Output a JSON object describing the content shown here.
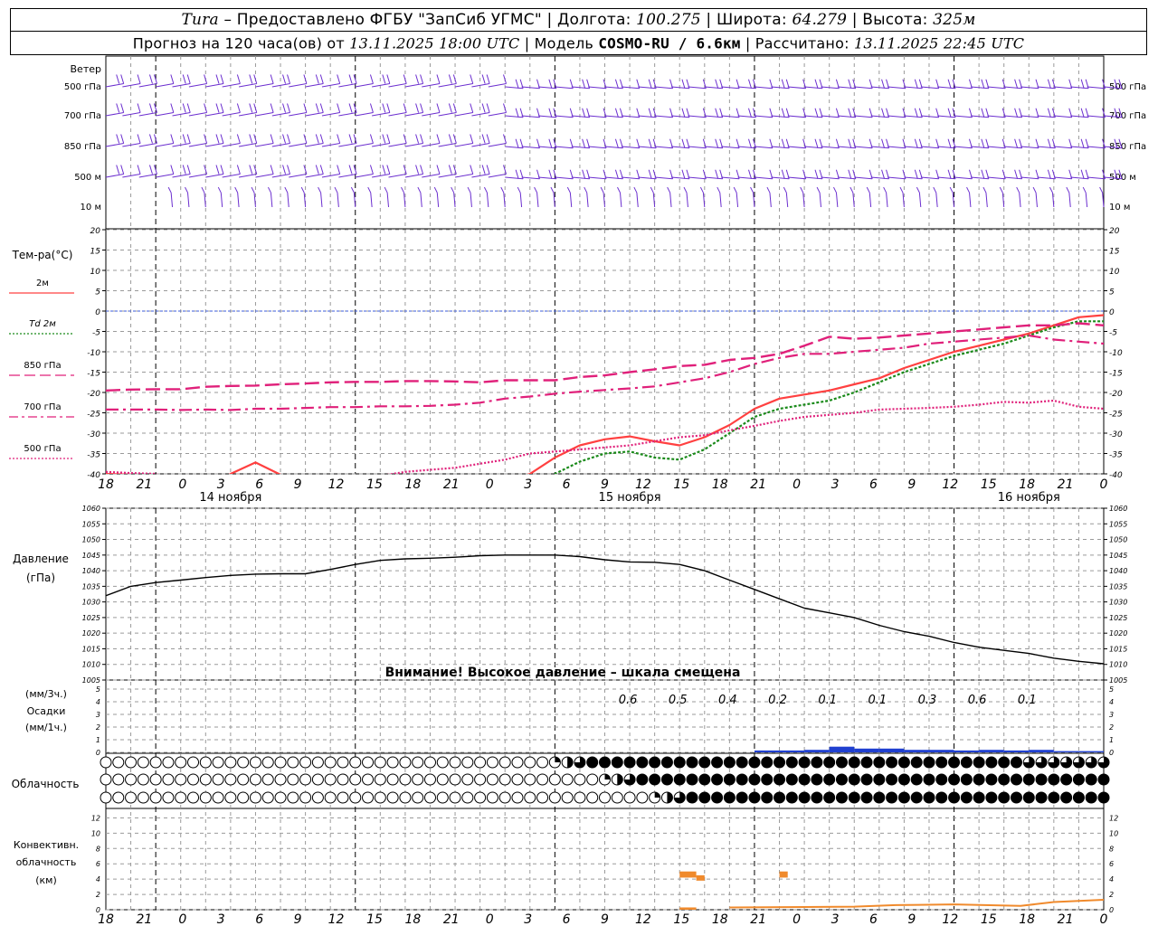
{
  "header": {
    "station": "Tura",
    "provider": " – Предоставлено ФГБУ \"ЗапСиб УГМС\" | Долгота: ",
    "longitude": "100.275",
    "lat_label": " | Широта: ",
    "latitude": "64.279",
    "alt_label": " | Высота: ",
    "altitude": "325м",
    "forecast_prefix": "Прогноз на 120 часа(ов) от ",
    "forecast_start": "13.11.2025 18:00 UTC",
    "model_label": "  | Модель ",
    "model": "COSMO-RU / 6.6км",
    "computed_label": " | Рассчитано: ",
    "computed": "13.11.2025 22:45 UTC"
  },
  "time_axis": {
    "hour_labels": [
      "18",
      "21",
      "0",
      "3",
      "6",
      "9",
      "12",
      "15",
      "18",
      "21",
      "0",
      "3",
      "6",
      "9",
      "12",
      "15",
      "18",
      "21",
      "0",
      "3",
      "6",
      "9",
      "12",
      "15",
      "18",
      "21",
      "0"
    ],
    "day_labels": [
      "14 ноября",
      "15 ноября",
      "16 ноября"
    ]
  },
  "wind": {
    "title": "Ветер",
    "levels": [
      "500 гПа",
      "700 гПа",
      "850 гПа",
      "500 м",
      "10  м"
    ]
  },
  "temperature": {
    "title": "Тем-ра(°C)",
    "legend": [
      {
        "label": "2м",
        "color": "#ff4040",
        "style": "solid"
      },
      {
        "label": "Td  2м",
        "color": "#1a8a1a",
        "style": "dotted"
      },
      {
        "label": "850 гПа",
        "color": "#e0207a",
        "style": "longdash"
      },
      {
        "label": "700 гПа",
        "color": "#e0207a",
        "style": "dashdot"
      },
      {
        "label": "500 гПа",
        "color": "#e0207a",
        "style": "dotted"
      }
    ],
    "ylim": [
      -40,
      20
    ],
    "ticks": [
      20,
      15,
      10,
      5,
      0,
      -5,
      -10,
      -15,
      -20,
      -25,
      -30,
      -35,
      -40
    ]
  },
  "pressure": {
    "title_line1": "Давление",
    "title_line2": "(гПа)",
    "ylim": [
      1005,
      1060
    ],
    "ticks": [
      1060,
      1055,
      1050,
      1045,
      1040,
      1035,
      1030,
      1025,
      1020,
      1015,
      1010,
      1005
    ],
    "warning": "Внимание! Высокое давление – шкала смещена"
  },
  "precip": {
    "unit3": "(мм/3ч.)",
    "title": "Осадки",
    "unit1": "(мм/1ч.)",
    "ticks": [
      5,
      4,
      3,
      2,
      1,
      0
    ],
    "totals": [
      "0.6",
      "0.5",
      "0.4",
      "0.2",
      "0.1",
      "0.1",
      "0.3",
      "0.6",
      "0.1"
    ]
  },
  "cloud": {
    "title": "Облачность"
  },
  "convective": {
    "title_line1": "Конвективн.",
    "title_line2": "облачность",
    "title_line3": "(км)",
    "ticks": [
      12,
      10,
      8,
      6,
      4,
      2,
      0
    ]
  },
  "chart_data": [
    {
      "type": "line",
      "title": "Тем-ра(°C)",
      "x_hours_from_start": [
        0,
        3,
        6,
        9,
        12,
        15,
        18,
        21,
        24,
        27,
        30,
        33,
        36,
        39,
        42,
        45,
        48,
        51,
        54,
        57,
        60,
        63,
        66,
        69,
        72,
        75,
        78,
        81,
        84,
        87,
        90,
        93,
        96,
        99,
        102,
        105,
        108,
        111,
        114,
        117,
        120
      ],
      "series": [
        {
          "name": "2м",
          "values": [
            -40,
            -40.2,
            -40.5,
            -42,
            -44,
            -40,
            -37.2,
            -40.2,
            -44,
            -46,
            -47,
            -48,
            -47,
            -47,
            -46,
            -44,
            -42,
            -40,
            -36,
            -33,
            -31.5,
            -30.8,
            -32,
            -33,
            -31,
            -28,
            -24,
            -21.5,
            -20.5,
            -19.5,
            -18,
            -16.5,
            -14,
            -12,
            -10,
            -8.5,
            -7,
            -5.5,
            -3.5,
            -1.5,
            -1
          ]
        },
        {
          "name": "Td  2м",
          "values": [
            -44,
            -44.5,
            -45,
            -46,
            -47,
            -44,
            -41,
            -43,
            -47,
            -49,
            -50,
            -51,
            -50,
            -50,
            -49,
            -47,
            -45,
            -43,
            -40,
            -37,
            -35,
            -34.5,
            -36,
            -36.5,
            -34,
            -30,
            -26,
            -24,
            -23,
            -22,
            -20,
            -17.5,
            -15,
            -13,
            -11,
            -9.5,
            -8,
            -6,
            -4,
            -2.5,
            -2.5
          ]
        },
        {
          "name": "850 гПа",
          "values": [
            -19.5,
            -19.3,
            -19.2,
            -19.2,
            -18.6,
            -18.4,
            -18.3,
            -18,
            -17.8,
            -17.5,
            -17.4,
            -17.4,
            -17.2,
            -17.2,
            -17.3,
            -17.5,
            -17.0,
            -17.0,
            -17.0,
            -16.2,
            -15.8,
            -15.0,
            -14.3,
            -13.5,
            -13.2,
            -12,
            -11.5,
            -10.5,
            -8.5,
            -6.3,
            -6.8,
            -6.5,
            -6,
            -5.5,
            -5,
            -4.5,
            -4,
            -3.5,
            -3.5,
            -3,
            -3.5
          ]
        },
        {
          "name": "700 гПа",
          "values": [
            -24.2,
            -24.2,
            -24.2,
            -24.3,
            -24.2,
            -24.3,
            -24.0,
            -24.0,
            -23.8,
            -23.6,
            -23.6,
            -23.4,
            -23.4,
            -23.3,
            -23.0,
            -22.5,
            -21.5,
            -21,
            -20.3,
            -19.8,
            -19.4,
            -19.0,
            -18.5,
            -17.5,
            -16.5,
            -15,
            -13,
            -11.5,
            -10.5,
            -10.5,
            -10,
            -9.5,
            -9,
            -8,
            -7.5,
            -7,
            -6.5,
            -6,
            -7,
            -7.5,
            -8
          ]
        },
        {
          "name": "500 гПа",
          "values": [
            -39.5,
            -39.8,
            -40,
            -43,
            -46,
            -44,
            -43,
            -42,
            -41,
            -41,
            -40.5,
            -40.5,
            -39.5,
            -39,
            -38.5,
            -37.5,
            -36.5,
            -35,
            -34.5,
            -34,
            -33.5,
            -33,
            -32,
            -31,
            -30.5,
            -29.3,
            -28.2,
            -27,
            -26,
            -25.5,
            -25,
            -24.2,
            -24,
            -23.8,
            -23.5,
            -23,
            -22.3,
            -22.5,
            -22,
            -23.5,
            -24
          ]
        }
      ],
      "ylabel": "°C",
      "ylim": [
        -40,
        20
      ]
    },
    {
      "type": "line",
      "title": "Давление",
      "x_hours_from_start": [
        0,
        3,
        6,
        9,
        12,
        15,
        18,
        21,
        24,
        27,
        30,
        33,
        36,
        39,
        42,
        45,
        48,
        51,
        54,
        57,
        60,
        63,
        66,
        69,
        72,
        75,
        78,
        81,
        84,
        87,
        90,
        93,
        96,
        99,
        102,
        105,
        108,
        111,
        114,
        117,
        120
      ],
      "series": [
        {
          "name": "",
          "values": [
            1032,
            1035,
            1036.2,
            1037,
            1037.8,
            1038.5,
            1038.9,
            1039,
            1039,
            1040.4,
            1042,
            1043.3,
            1043.8,
            1044,
            1044.3,
            1044.8,
            1045,
            1045,
            1045,
            1044.5,
            1043.5,
            1042.8,
            1042.7,
            1042,
            1040,
            1037,
            1034,
            1031,
            1028,
            1026.5,
            1025,
            1022.5,
            1020.5,
            1019,
            1017,
            1015.5,
            1014.5,
            1013.5,
            1012,
            1011,
            1010.2
          ]
        }
      ],
      "ylabel": "гПа",
      "ylim": [
        1005,
        1060
      ]
    },
    {
      "type": "bar",
      "title": "Осадки",
      "x_hours_from_start": [
        57,
        60,
        63,
        66,
        69,
        72,
        75,
        78,
        81,
        84,
        87,
        90,
        93,
        96,
        99,
        102,
        105,
        108,
        111,
        114,
        117
      ],
      "values": [
        0,
        0,
        0,
        0,
        0,
        0,
        0,
        0.15,
        0.15,
        0.2,
        0.45,
        0.3,
        0.3,
        0.2,
        0.2,
        0.15,
        0.2,
        0.15,
        0.2,
        0.1,
        0.1
      ],
      "totals_24h": [
        "0.6",
        "0.5",
        "0.4",
        "0.2",
        "0.1",
        "0.1",
        "0.3",
        "0.6",
        "0.1"
      ],
      "ylim": [
        0,
        5
      ]
    },
    {
      "type": "bar",
      "title": "Конвективная облачность",
      "segments": [
        {
          "x_start_h": 69,
          "x_end_h": 71,
          "bottom_km": 0,
          "top_km": 0.3
        },
        {
          "x_start_h": 69,
          "x_end_h": 71,
          "bottom_km": 4.2,
          "top_km": 5
        },
        {
          "x_start_h": 71,
          "x_end_h": 72,
          "bottom_km": 3.8,
          "top_km": 4.5
        },
        {
          "x_start_h": 81,
          "x_end_h": 82,
          "bottom_km": 4.2,
          "top_km": 5
        }
      ],
      "ylim": [
        0,
        13
      ]
    }
  ]
}
